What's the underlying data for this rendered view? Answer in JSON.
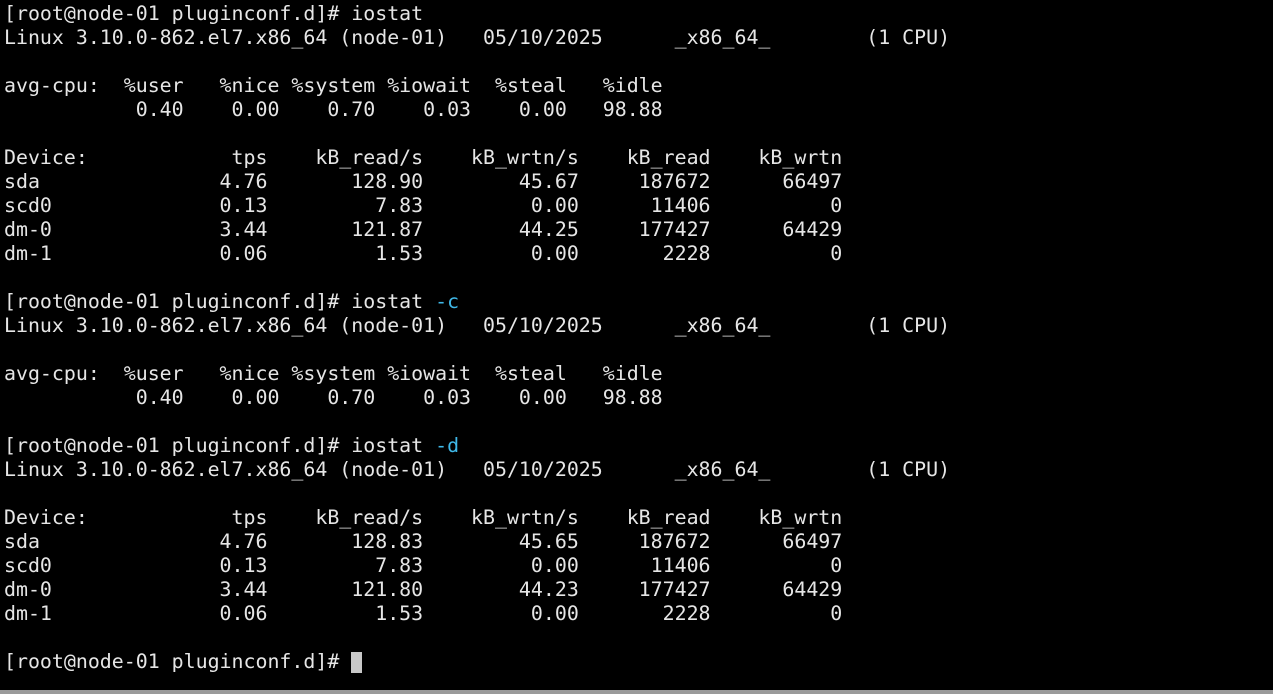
{
  "colors": {
    "background": "#000000",
    "foreground": "#e6e6e6",
    "flag": "#3fb8e8",
    "cursor": "#c8c8c8"
  },
  "session": {
    "prompt": "[root@node-01 pluginconf.d]# ",
    "cmd1": {
      "command": "iostat",
      "header": "Linux 3.10.0-862.el7.x86_64 (node-01)   05/10/2025      _x86_64_        (1 CPU)",
      "cpu_header": "avg-cpu:  %user   %nice %system %iowait  %steal   %idle",
      "cpu_values": "           0.40    0.00    0.70    0.03    0.00   98.88",
      "dev_header": "Device:            tps    kB_read/s    kB_wrtn/s    kB_read    kB_wrtn",
      "rows": [
        "sda               4.76       128.90        45.67     187672      66497",
        "scd0              0.13         7.83         0.00      11406          0",
        "dm-0              3.44       121.87        44.25     177427      64429",
        "dm-1              0.06         1.53         0.00       2228          0"
      ]
    },
    "cmd2": {
      "command": "iostat",
      "flag": "-c",
      "header": "Linux 3.10.0-862.el7.x86_64 (node-01)   05/10/2025      _x86_64_        (1 CPU)",
      "cpu_header": "avg-cpu:  %user   %nice %system %iowait  %steal   %idle",
      "cpu_values": "           0.40    0.00    0.70    0.03    0.00   98.88"
    },
    "cmd3": {
      "command": "iostat",
      "flag": "-d",
      "header": "Linux 3.10.0-862.el7.x86_64 (node-01)   05/10/2025      _x86_64_        (1 CPU)",
      "dev_header": "Device:            tps    kB_read/s    kB_wrtn/s    kB_read    kB_wrtn",
      "rows": [
        "sda               4.76       128.83        45.65     187672      66497",
        "scd0              0.13         7.83         0.00      11406          0",
        "dm-0              3.44       121.80        44.23     177427      64429",
        "dm-1              0.06         1.53         0.00       2228          0"
      ]
    }
  }
}
